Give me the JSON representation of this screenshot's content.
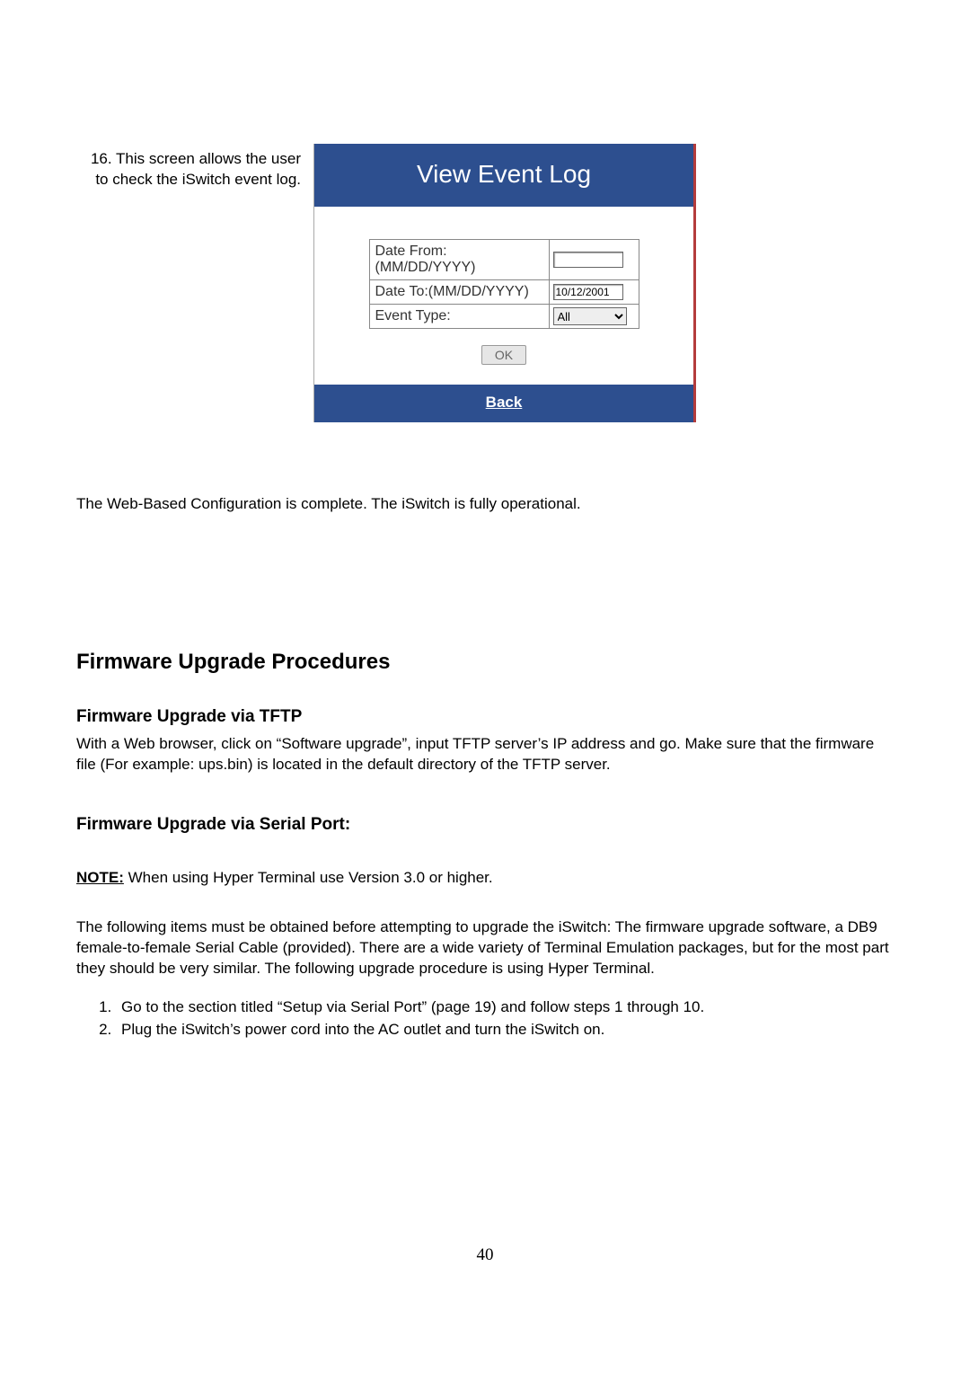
{
  "step": {
    "text": "16. This screen allows the user to check the iSwitch event log."
  },
  "panel": {
    "title": "View Event Log",
    "fields": {
      "date_from_label": "Date From:(MM/DD/YYYY)",
      "date_from_value": "",
      "date_to_label": "Date To:(MM/DD/YYYY)",
      "date_to_value": "10/12/2001",
      "event_type_label": "Event Type:",
      "event_type_value": "All"
    },
    "ok": "OK",
    "back": "Back"
  },
  "after_panel": "The Web-Based Configuration is complete.  The iSwitch is fully operational.",
  "heading_main": "Firmware Upgrade Procedures",
  "heading_tftp": "Firmware Upgrade via TFTP",
  "tftp_body": "With a Web browser, click on “Software upgrade”, input TFTP server’s IP address and go.  Make sure that the firmware file (For example: ups.bin) is located in the default directory of the TFTP server.",
  "heading_serial": "Firmware Upgrade via Serial Port:",
  "note_label": "NOTE:",
  "note_body": "  When using Hyper Terminal use Version 3.0 or higher.",
  "serial_intro": "The following items must be obtained before attempting to upgrade the iSwitch:  The firmware upgrade software, a DB9 female-to-female Serial Cable (provided).  There are a wide variety of Terminal Emulation packages, but for the most part they should be very similar.  The following upgrade procedure is using Hyper Terminal.",
  "steps": [
    "Go to the section titled “Setup via Serial Port” (page 19) and follow steps 1 through 10.",
    "Plug the iSwitch’s power cord into the AC outlet and turn the iSwitch on."
  ],
  "page_number": "40"
}
